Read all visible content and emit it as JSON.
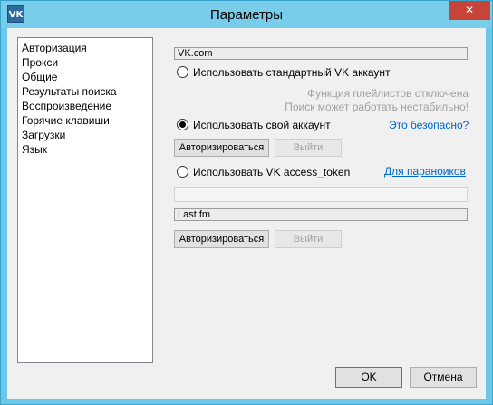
{
  "window": {
    "title": "Параметры",
    "minimize_glyph": "—",
    "maximize_glyph": "☐",
    "close_glyph": "✕",
    "icon_text": "VK"
  },
  "sidebar": {
    "items": [
      {
        "label": "Авторизация"
      },
      {
        "label": "Прокси"
      },
      {
        "label": "Общие"
      },
      {
        "label": "Результаты поиска"
      },
      {
        "label": "Воспроизведение"
      },
      {
        "label": "Горячие клавиши"
      },
      {
        "label": "Загрузки"
      },
      {
        "label": "Язык"
      }
    ]
  },
  "vk": {
    "section_label": "VK.com",
    "option_standard": "Использовать стандартный VK аккаунт",
    "notice_line1": "Функция плейлистов отключена",
    "notice_line2": "Поиск может работать нестабильно!",
    "option_own": "Использовать свой аккаунт",
    "safe_link": "Это безопасно?",
    "login_button": "Авторизироваться",
    "logout_button": "Выйти",
    "option_token": "Использовать VK access_token",
    "paranoid_link": "Для параноиков",
    "token_value": "",
    "selected_option": "own"
  },
  "lastfm": {
    "section_label": "Last.fm",
    "login_button": "Авторизироваться",
    "logout_button": "Выйти"
  },
  "footer": {
    "ok_button": "OK",
    "cancel_button": "Отмена"
  }
}
